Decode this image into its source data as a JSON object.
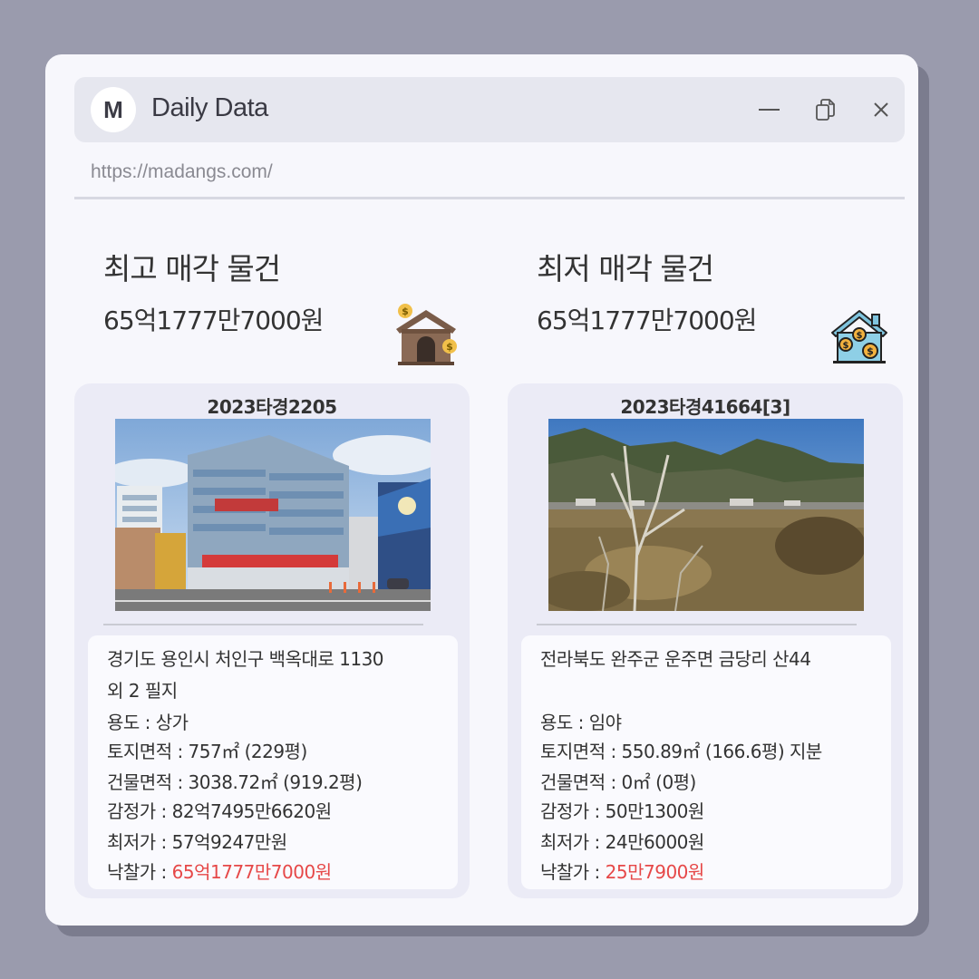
{
  "app": {
    "logo_letter": "M",
    "title": "Daily Data",
    "url": "https://madangs.com/"
  },
  "left": {
    "heading": "최고 매각 물건",
    "price": "65억1777만7000원",
    "case_no": "2023타경2205",
    "address_line1": "경기도 용인시 처인구 백옥대로 1130",
    "address_line2": "외 2 필지",
    "usage": "용도 : 상가",
    "land_area": "토지면적 : 757㎡ (229평)",
    "building_area": "건물면적 : 3038.72㎡ (919.2평)",
    "appraisal": "감정가 : 82억7495만6620원",
    "minimum": "최저가 : 57억9247만원",
    "winning_label": "낙찰가 : ",
    "winning_value": "65억1777만7000원"
  },
  "right": {
    "heading": "최저 매각 물건",
    "price": "65억1777만7000원",
    "case_no": "2023타경41664[3]",
    "address_line1": "전라북도 완주군 운주면 금당리 산44",
    "usage": "용도 : 임야",
    "land_area": "토지면적 : 550.89㎡ (166.6평) 지분",
    "building_area": "건물면적 : 0㎡ (0평)",
    "appraisal": "감정가 : 50만1300원",
    "minimum": "최저가 : 24만6000원",
    "winning_label": "낙찰가 : ",
    "winning_value": "25만7900원"
  },
  "icons": {
    "minimize": "minimize-icon",
    "restore": "restore-icon",
    "close": "close-icon",
    "left_deco": "house-coin-icon",
    "right_deco": "house-money-icon"
  },
  "colors": {
    "background": "#9a9bad",
    "window": "#f7f7fc",
    "titlebar": "#e6e7ef",
    "card": "#ebebf6",
    "highlight": "#e64848"
  }
}
